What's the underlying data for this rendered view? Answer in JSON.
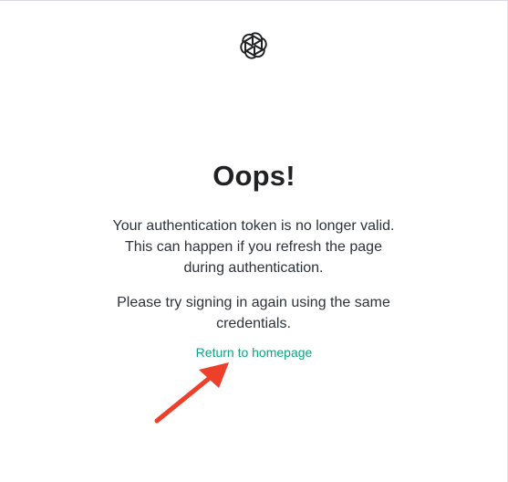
{
  "logo": {
    "icon": "openai-logo-icon"
  },
  "error": {
    "title": "Oops!",
    "message_line1": "Your authentication token is no longer valid.",
    "message_line2": "This can happen if you refresh the page",
    "message_line3": "during authentication.",
    "instruction_line1": "Please try signing in again using the same",
    "instruction_line2": "credentials."
  },
  "link": {
    "return_label": "Return to homepage"
  },
  "annotation": {
    "icon": "red-arrow-icon",
    "color": "#ee3f2a"
  },
  "colors": {
    "accent": "#10a37f",
    "text": "#2d333a",
    "title": "#202123"
  }
}
